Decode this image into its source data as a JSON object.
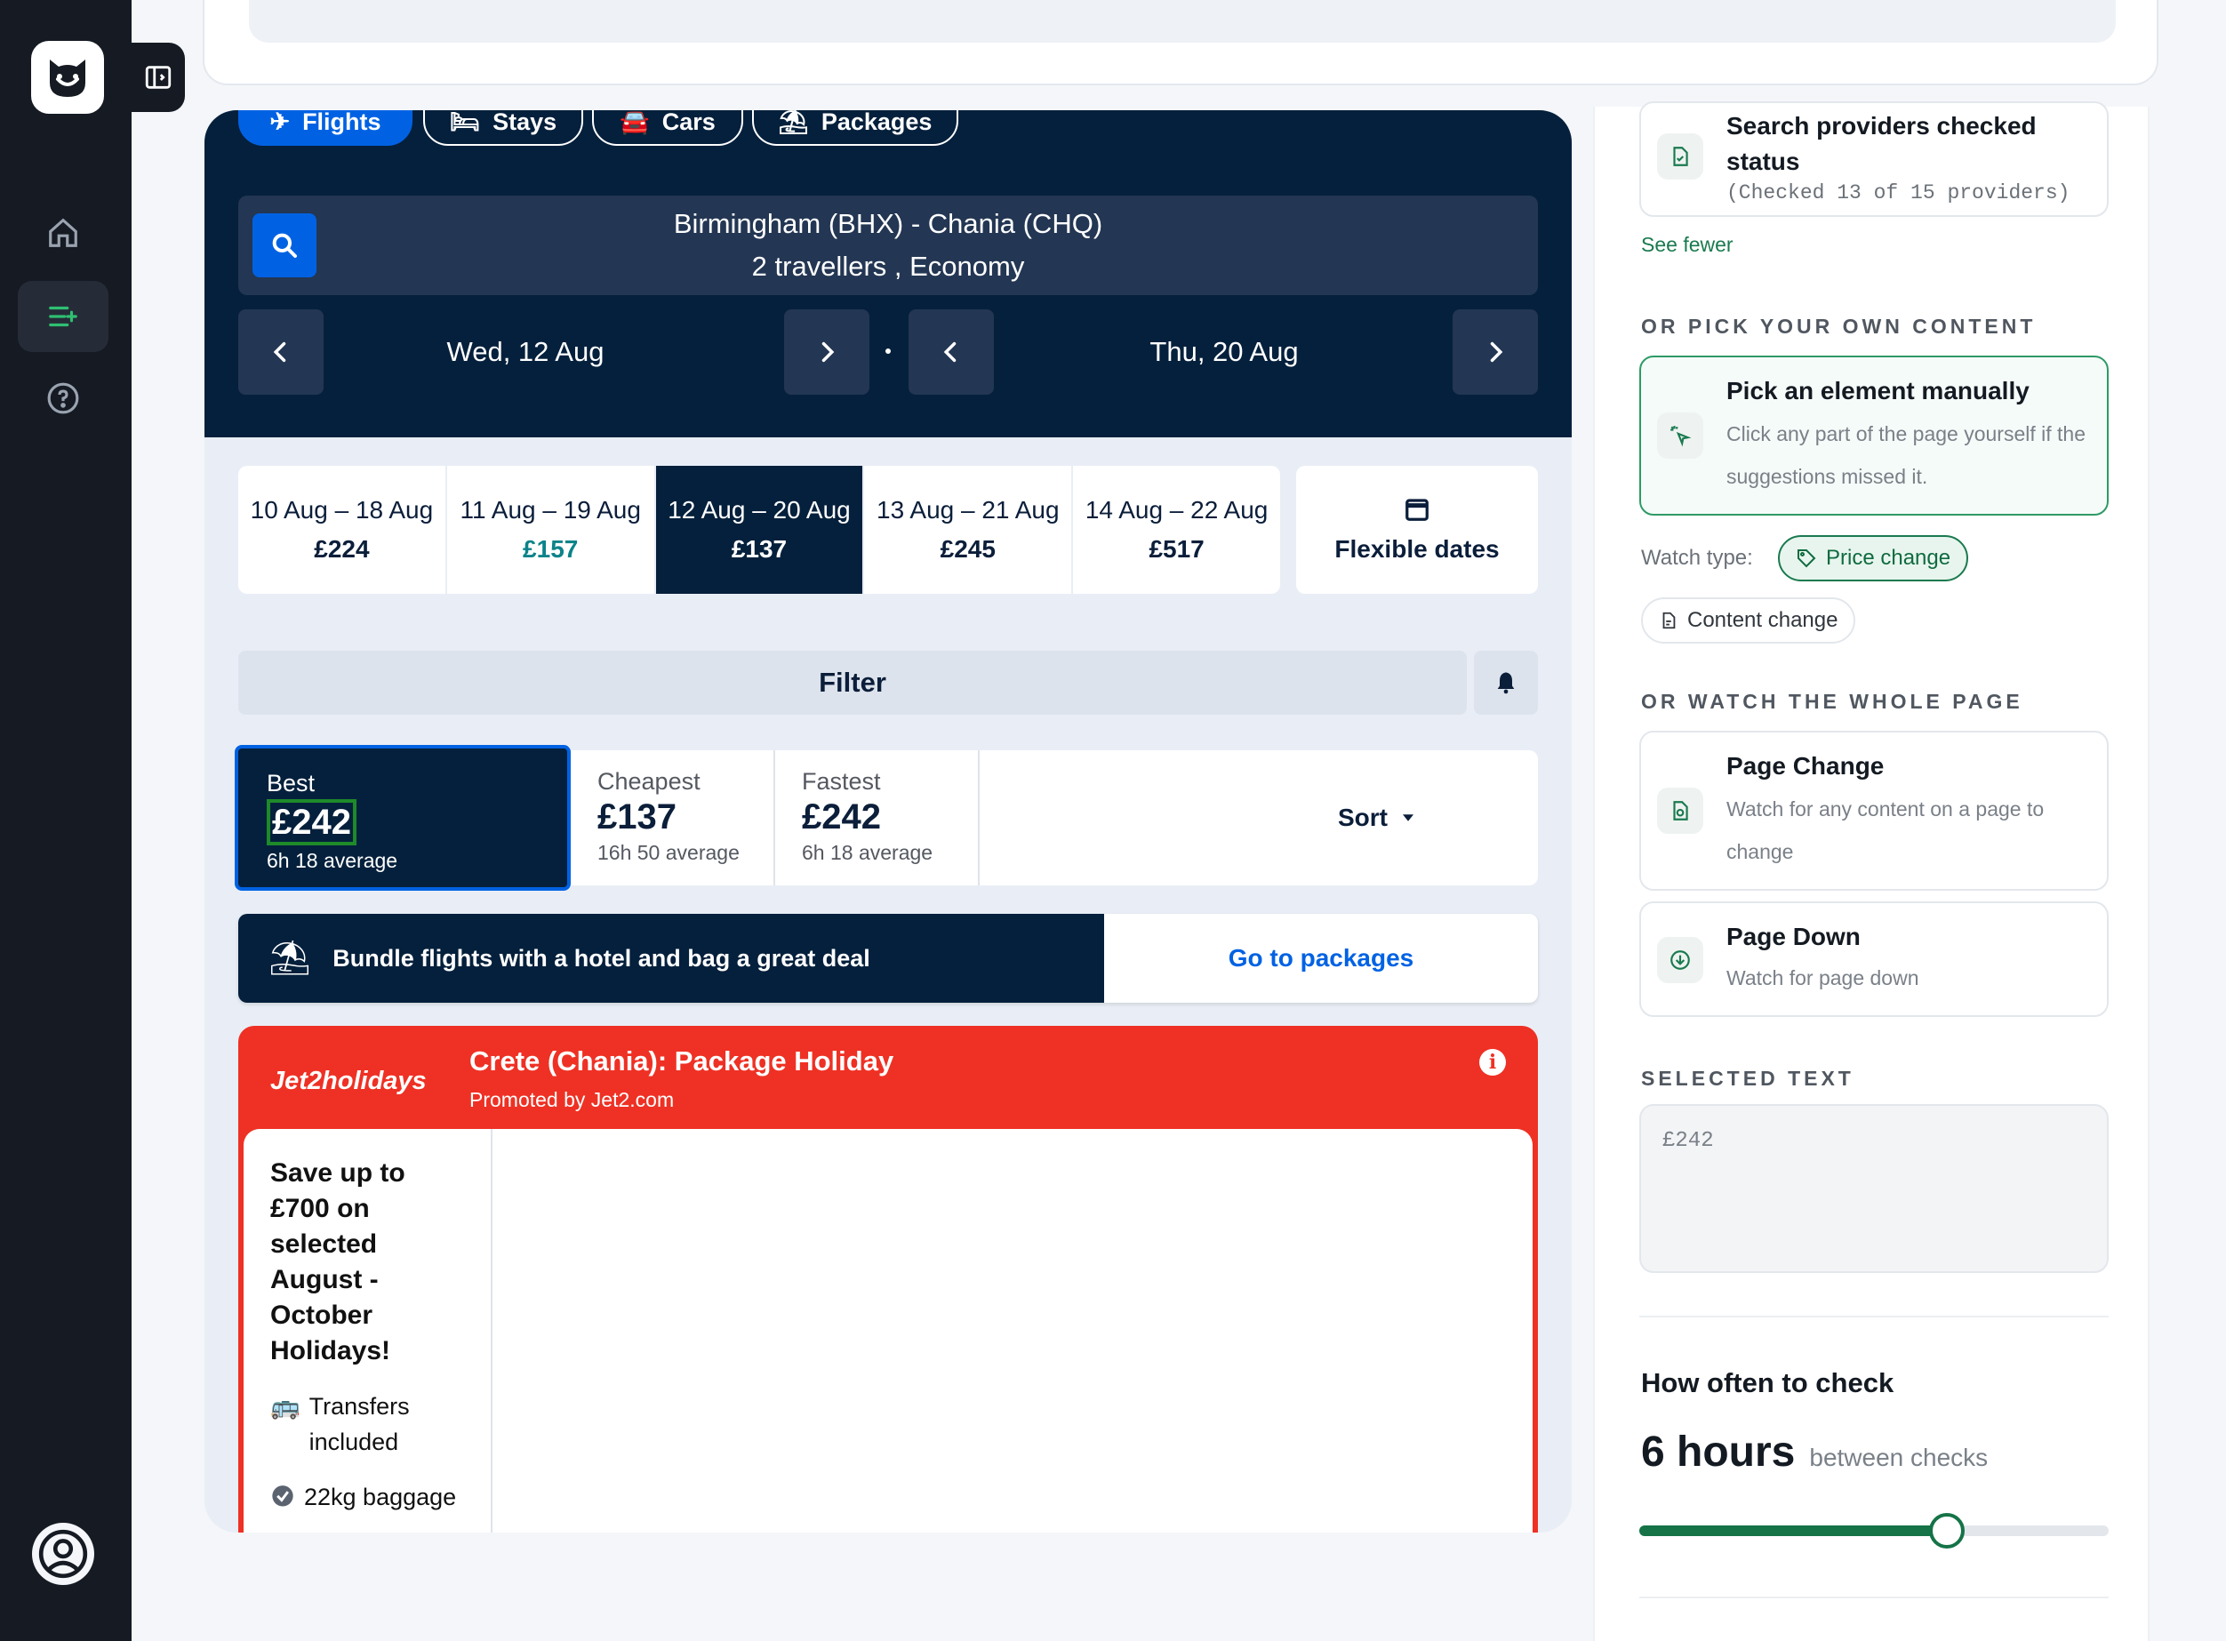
{
  "sidebar": {
    "logo": "cat-logo",
    "icons": [
      "home-icon",
      "watch-list-icon",
      "help-icon",
      "account-icon"
    ]
  },
  "flight_widget": {
    "tabs": [
      {
        "label": "Flights",
        "icon": "plane-icon",
        "active": true
      },
      {
        "label": "Stays",
        "icon": "bed-icon",
        "active": false
      },
      {
        "label": "Cars",
        "icon": "car-icon",
        "active": false
      },
      {
        "label": "Packages",
        "icon": "beach-icon",
        "active": false
      }
    ],
    "search": {
      "route": "Birmingham (BHX) - Chania (CHQ)",
      "passengers": "2 travellers , Economy"
    },
    "depart_date": "Wed, 12 Aug",
    "return_date": "Thu, 20 Aug",
    "date_options": [
      {
        "range": "10 Aug – 18 Aug",
        "price": "£224"
      },
      {
        "range": "11 Aug – 19 Aug",
        "price": "£157"
      },
      {
        "range": "12 Aug – 20 Aug",
        "price": "£137"
      },
      {
        "range": "13 Aug – 21 Aug",
        "price": "£245"
      },
      {
        "range": "14 Aug – 22 Aug",
        "price": "£517"
      }
    ],
    "flexible_dates_label": "Flexible dates",
    "filter_label": "Filter",
    "sort_options": [
      {
        "label": "Best",
        "price": "£242",
        "sub": "6h 18 average"
      },
      {
        "label": "Cheapest",
        "price": "£137",
        "sub": "16h 50 average"
      },
      {
        "label": "Fastest",
        "price": "£242",
        "sub": "6h 18 average"
      }
    ],
    "sort_label": "Sort",
    "bundle_text": "Bundle flights with a hotel and bag a great deal",
    "bundle_link": "Go to packages",
    "ad": {
      "logo": "Jet2holidays",
      "title": "Crete (Chania): Package Holiday",
      "promoted": "Promoted by Jet2.com",
      "headline": "Save up to £700 on selected August - October Holidays!",
      "features": [
        "Transfers included",
        "22kg baggage"
      ]
    }
  },
  "right_panel": {
    "provider_status_title": "Search providers checked status",
    "provider_status_detail": "(Checked 13 of 15 providers)",
    "see_fewer": "See fewer",
    "pick_section": "OR PICK YOUR OWN CONTENT",
    "pick_title": "Pick an element manually",
    "pick_desc": "Click any part of the page yourself if the suggestions missed it.",
    "watch_type_label": "Watch type:",
    "watch_types": [
      "Price change",
      "Content change"
    ],
    "whole_page_section": "OR WATCH THE WHOLE PAGE",
    "page_change_title": "Page Change",
    "page_change_desc": "Watch for any content on a page to change",
    "page_down_title": "Page Down",
    "page_down_desc": "Watch for page down",
    "selected_text_section": "SELECTED TEXT",
    "selected_text_value": "£242",
    "frequency_title": "How often to check",
    "frequency_value": "6 hours",
    "frequency_suffix": "between checks",
    "frequency_slider_fraction": 0.655
  },
  "colors": {
    "sidebar": "#151a23",
    "navy": "#05203c",
    "accent_blue": "#0062e3",
    "ad_red": "#ee3124",
    "green": "#157347"
  }
}
